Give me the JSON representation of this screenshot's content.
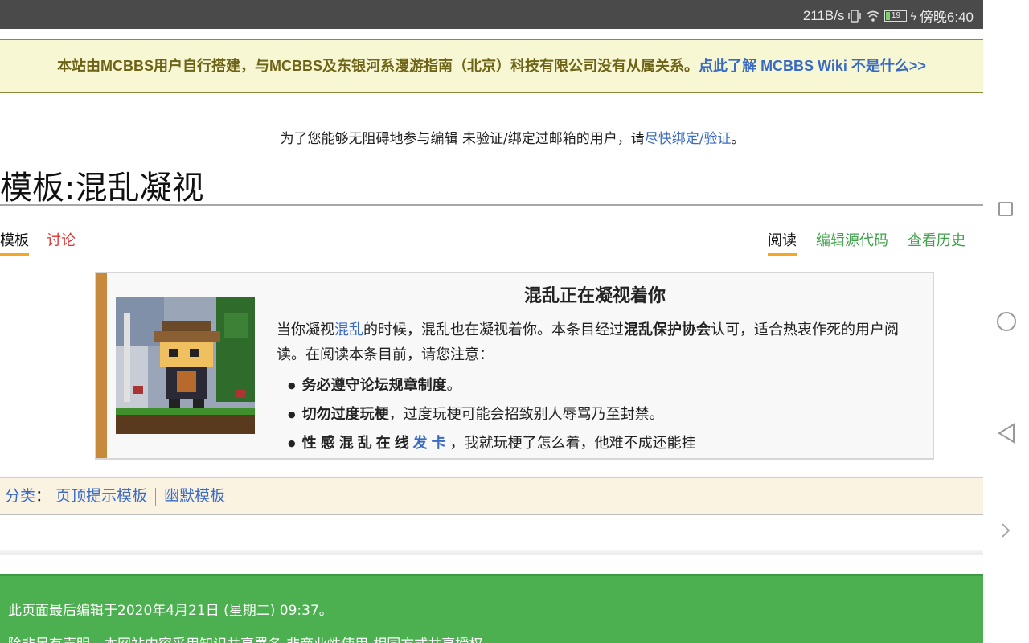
{
  "status_bar": {
    "net_speed": "211B/s",
    "battery": "19",
    "time": "傍晚6:40"
  },
  "site_notice": {
    "text": "本站由MCBBS用户自行搭建，与MCBBS及东银河系漫游指南（北京）科技有限公司没有从属关系。",
    "link": "点此了解 MCBBS Wiki 不是什么>>"
  },
  "email_notice": {
    "text": "为了您能够无阻碍地参与编辑 未验证/绑定过邮箱的用户，请",
    "link": "尽快绑定/验证",
    "suffix": "。"
  },
  "page_title": "模板:混乱凝视",
  "tabs_left": [
    {
      "label": "模板"
    },
    {
      "label": "讨论"
    }
  ],
  "tabs_right": [
    {
      "label": "阅读"
    },
    {
      "label": "编辑源代码"
    },
    {
      "label": "查看历史"
    }
  ],
  "ambox": {
    "heading": "混乱正在凝视着你",
    "p1_a": "当你凝视",
    "p1_link": "混乱",
    "p1_b": "的时候，混乱也在凝视着你。本条目经过",
    "p1_bold": "混乱保护协会",
    "p1_c": "认可，适合热衷作死的用户阅读。在阅读本条目前，请您注意：",
    "item1_bold": "务必遵守论坛规章制度",
    "item1_rest": "。",
    "item2_bold": "切勿过度玩梗",
    "item2_rest": "，过度玩梗可能会招致别人辱骂乃至封禁。",
    "item3_bold": "性感混乱在线",
    "item3_link": "发卡",
    "item3_rest": "，我就玩梗了怎么着，他难不成还能挂"
  },
  "categories": {
    "label": "分类",
    "colon": "：",
    "items": [
      "页顶提示模板",
      "幽默模板"
    ]
  },
  "footer": {
    "last_edited": "此页面最后编辑于2020年4月21日 (星期二) 09:37。",
    "license": "除非另有声明，本网站内容采用知识共享署名-非商业性使用-相同方式共享授权。"
  },
  "colors": {
    "notice_bg": "#f7f7d3",
    "accent_tab": "#f5a623",
    "footer_bg": "#4caf50",
    "ambox_bar": "#c78a3c"
  }
}
